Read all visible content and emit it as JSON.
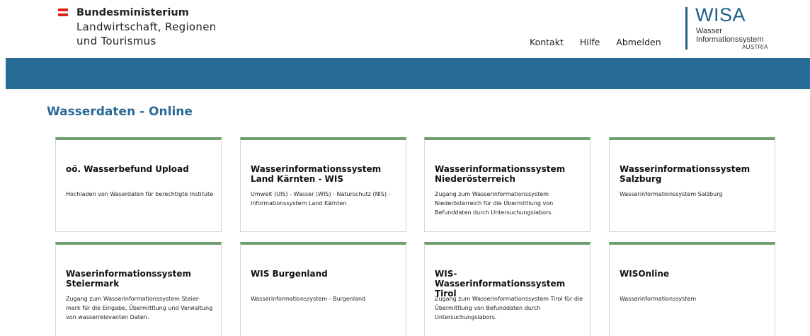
{
  "ministry": {
    "line1": "Bundesministerium",
    "line2": "Landwirtschaft, Regionen",
    "line3": "und Tourismus"
  },
  "nav": {
    "kontakt": "Kontakt",
    "hilfe": "Hilfe",
    "abmelden": "Abmelden"
  },
  "logo": {
    "big": "WISA",
    "line1": "Wasser",
    "line2": "Informationssystem",
    "line3": "AUSTRIA"
  },
  "page": {
    "title": "Wasserdaten - Online"
  },
  "cards": [
    {
      "title": "oö. Wasserbefund Upload",
      "desc": "Hochladen von Waserdaten für berechtigte Institute"
    },
    {
      "title": "Wasserinformationssystem Land Kärnten - WIS",
      "desc": "Umwelt (UIS) - Wasser (WIS) - Naturschutz (NIS) - Informationssystem Land Kärnten"
    },
    {
      "title": "Wasserinformationssystem Niederösterreich",
      "desc": "Zugang zum Wasserinformationssystem Niederösterreich für die Übermittlung von Befunddaten durch Untersuchungslabors."
    },
    {
      "title": "Wasserinformationssystem Salzburg",
      "desc": "Wasserinformationssystem Salzburg"
    },
    {
      "title": "Waserinformationssystem Steiermark",
      "desc": "Zugang zum Wasserinformationssystem Steier- mark für die Eingabe, Übermittlung und Verwaltung von wasserrelevanten Daten."
    },
    {
      "title": "WIS Burgenland",
      "desc": "Wasserinformationssystem - Burgenland"
    },
    {
      "title": "WIS-Wasserinformationssystem Tirol",
      "desc": "Zugang zum Wasserinformationssystem Tirol für die Übermittlung von Befunddaten durch Untersuchungslabors."
    },
    {
      "title": "WISOnline",
      "desc": "Wasserinformationssystem"
    }
  ],
  "colors": {
    "band": "#286c98",
    "title": "#2b6a97",
    "card_top": "#6e9e6e",
    "flag_red": "#e2231a"
  }
}
